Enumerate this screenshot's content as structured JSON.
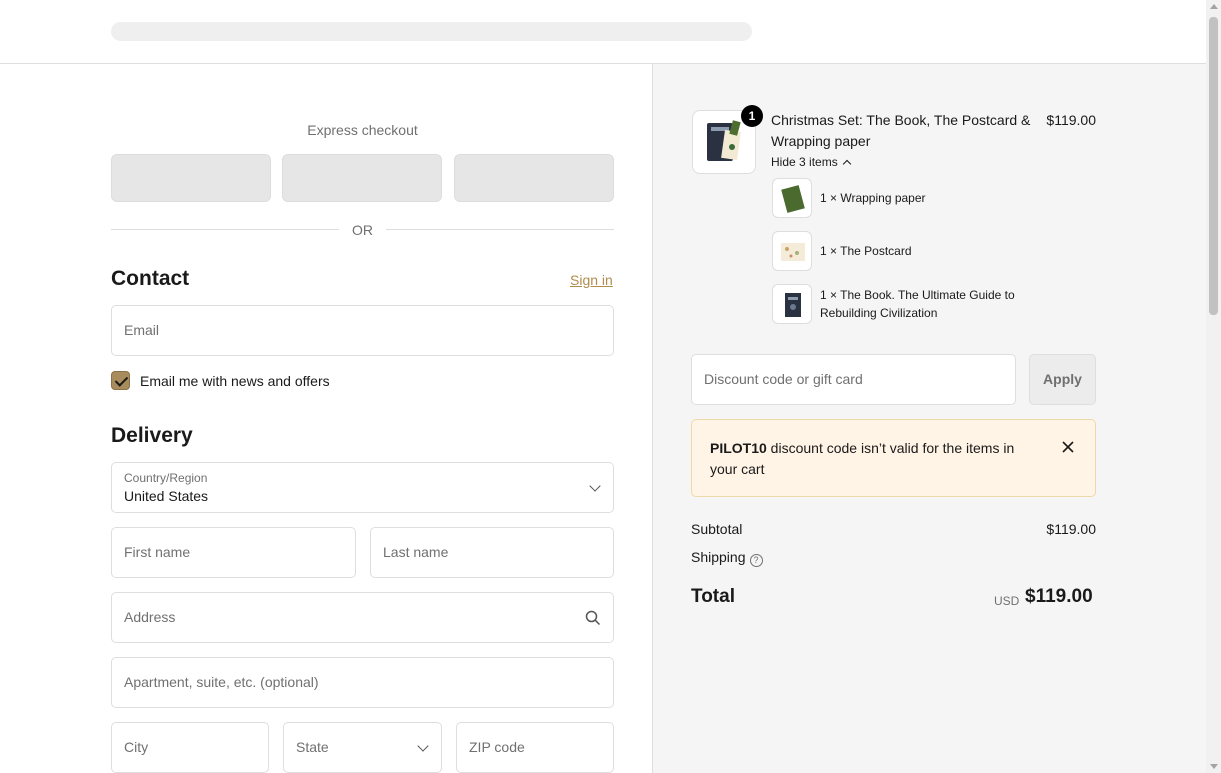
{
  "express": {
    "title": "Express checkout",
    "or": "OR"
  },
  "contact": {
    "heading": "Contact",
    "signin": "Sign in",
    "email_placeholder": "Email",
    "newsletter_label": "Email me with news and offers",
    "newsletter_checked": true
  },
  "delivery": {
    "heading": "Delivery",
    "country_label": "Country/Region",
    "country_value": "United States",
    "first_name": "First name",
    "last_name": "Last name",
    "address": "Address",
    "apartment": "Apartment, suite, etc. (optional)",
    "city": "City",
    "state": "State",
    "zip": "ZIP code"
  },
  "cart": {
    "quantity_badge": "1",
    "product_name": "Christmas Set: The Book, The Postcard & Wrapping paper",
    "product_price": "$119.00",
    "hide_items": "Hide 3 items",
    "items": [
      {
        "text": "1 × Wrapping paper"
      },
      {
        "text": "1 × The Postcard"
      },
      {
        "text": "1 × The Book. The Ultimate Guide to Rebuilding Civilization"
      }
    ]
  },
  "discount": {
    "placeholder": "Discount code or gift card",
    "apply": "Apply",
    "error_code": "PILOT10",
    "error_msg": " discount code isn’t valid for the items in your cart"
  },
  "summary": {
    "subtotal_label": "Subtotal",
    "subtotal_value": "$119.00",
    "shipping_label": "Shipping",
    "total_label": "Total",
    "currency": "USD",
    "total_value": "$119.00"
  },
  "colors": {
    "accent": "#b08d4e",
    "checkbox": "#a88c5c",
    "alert_bg": "#fff4e5"
  }
}
